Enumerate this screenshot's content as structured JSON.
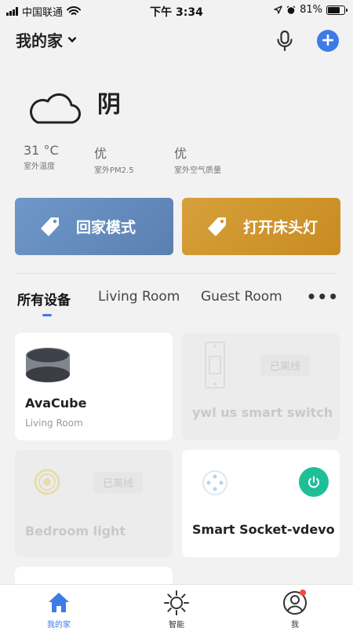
{
  "status_bar": {
    "carrier": "中国联通",
    "time": "下午 3:34",
    "battery": "81%",
    "battery_level": 0.81
  },
  "header": {
    "title": "我的家"
  },
  "weather": {
    "condition": "阴",
    "metrics": [
      {
        "value": "31 °C",
        "label": "室外温度"
      },
      {
        "value": "优",
        "label": "室外PM2.5"
      },
      {
        "value": "优",
        "label": "室外空气质量"
      }
    ]
  },
  "scenes": [
    {
      "label": "回家模式"
    },
    {
      "label": "打开床头灯"
    }
  ],
  "tabs": [
    "所有设备",
    "Living Room",
    "Guest Room"
  ],
  "devices": [
    {
      "name": "AvaCube",
      "room": "Living Room",
      "status": ""
    },
    {
      "name": "ywl us smart switch",
      "status": "已离线"
    },
    {
      "name": "Bedroom light",
      "status": "已离线"
    },
    {
      "name": "Smart Socket-vdevo",
      "status": ""
    }
  ],
  "tabbar": [
    {
      "label": "我的家"
    },
    {
      "label": "智能"
    },
    {
      "label": "我"
    }
  ],
  "colors": {
    "accent": "#3d7ce6",
    "scene_home": "#6f97c8",
    "scene_lamp": "#d6a03a",
    "power": "#1ebf97"
  }
}
